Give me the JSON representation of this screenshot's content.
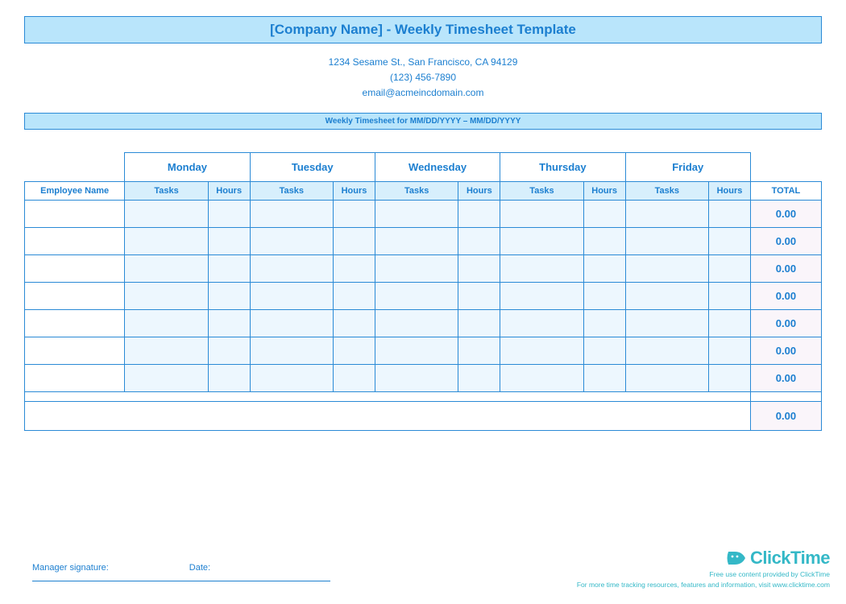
{
  "header": {
    "title": "[Company Name] - Weekly Timesheet Template",
    "address": "1234 Sesame St.,  San Francisco, CA 94129",
    "phone": "(123) 456-7890",
    "email": "email@acmeincdomain.com",
    "period": "Weekly Timesheet for MM/DD/YYYY – MM/DD/YYYY"
  },
  "columns": {
    "employee": "Employee Name",
    "days": [
      "Monday",
      "Tuesday",
      "Wednesday",
      "Thursday",
      "Friday"
    ],
    "subTasks": "Tasks",
    "subHours": "Hours",
    "total": "TOTAL"
  },
  "rows": [
    {
      "total": "0.00"
    },
    {
      "total": "0.00"
    },
    {
      "total": "0.00"
    },
    {
      "total": "0.00"
    },
    {
      "total": "0.00"
    },
    {
      "total": "0.00"
    },
    {
      "total": "0.00"
    }
  ],
  "grandTotal": "0.00",
  "signature": {
    "manager": "Manager signature:",
    "date": "Date:"
  },
  "footer": {
    "brand": "ClickTime",
    "line1": "Free use content provided by ClickTime",
    "line2": "For more time tracking resources, features and information, visit www.clicktime.com"
  }
}
